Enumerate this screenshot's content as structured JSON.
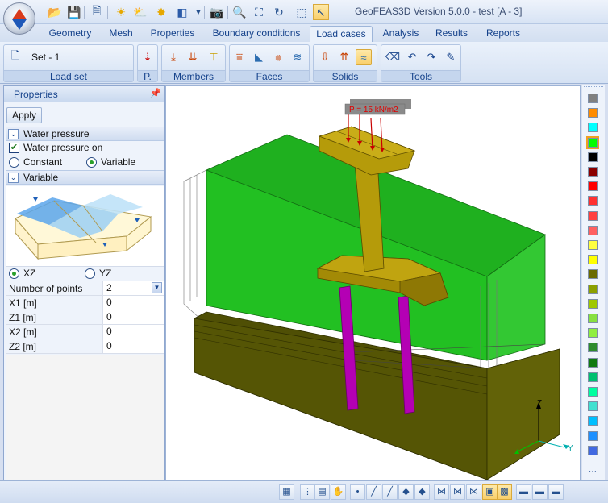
{
  "window": {
    "title": "GeoFEAS3D Version 5.0.0 - test [A - 3]"
  },
  "quick_access": [
    "open-icon",
    "save-icon",
    "print-preview-icon",
    "sun-icon",
    "cloud-sun-icon",
    "light-icon",
    "cube-icon",
    "dropdown-icon",
    "camera-icon",
    "zoom-icon",
    "zoom-window-icon",
    "rotate-icon",
    "select-icon",
    "pointer-icon"
  ],
  "tabs": [
    {
      "label": "Geometry",
      "active": false
    },
    {
      "label": "Mesh",
      "active": false
    },
    {
      "label": "Properties",
      "active": false
    },
    {
      "label": "Boundary conditions",
      "active": false
    },
    {
      "label": "Load cases",
      "active": true
    },
    {
      "label": "Analysis",
      "active": false
    },
    {
      "label": "Results",
      "active": false
    },
    {
      "label": "Reports",
      "active": false
    }
  ],
  "ribbon": {
    "load_set": {
      "label": "Load set",
      "value": "Set - 1"
    },
    "point": {
      "label": "P."
    },
    "members": {
      "label": "Members"
    },
    "faces": {
      "label": "Faces"
    },
    "solids": {
      "label": "Solids"
    },
    "tools": {
      "label": "Tools"
    }
  },
  "properties": {
    "title": "Properties",
    "apply_label": "Apply",
    "water_pressure_section": "Water pressure",
    "water_pressure_on_label": "Water pressure on",
    "water_pressure_on": true,
    "mode_constant": "Constant",
    "mode_variable": "Variable",
    "mode_selected": "Variable",
    "variable_section": "Variable",
    "plane_xz": "XZ",
    "plane_yz": "YZ",
    "plane_selected": "XZ",
    "rows": [
      {
        "key": "Number of points",
        "value": "2"
      },
      {
        "key": "X1  [m]",
        "value": "0"
      },
      {
        "key": "Z1  [m]",
        "value": "0"
      },
      {
        "key": "X2  [m]",
        "value": "0"
      },
      {
        "key": "Z2  [m]",
        "value": "0"
      }
    ]
  },
  "viewport": {
    "load_label": "P = 15 kN/m2",
    "axis_z": "Z",
    "axis_y": "Y",
    "colors": {
      "soil_top": "#1fa51f",
      "soil_bottom": "#5a5a06",
      "structure": "#b49a07",
      "piles": "#b400b4",
      "load": "#c80000"
    }
  },
  "palette": [
    "#808080",
    "#ff8c00",
    "#00ffff",
    "#00ff00",
    "#000000",
    "#8b0000",
    "#ff0000",
    "#ff3030",
    "#ff4040",
    "#ff6060",
    "#ffff40",
    "#ffff00",
    "#6b6b00",
    "#8ca000",
    "#a0c800",
    "#88e040",
    "#90ee40",
    "#2e8b2e",
    "#107a10",
    "#00c070",
    "#00ffa0",
    "#40e0d0",
    "#00bfff",
    "#1e90ff",
    "#4169e1"
  ],
  "statusbar_icons": [
    "grid-icon",
    "dots-grid-icon",
    "table-icon",
    "hand-icon",
    "point-icon",
    "line-icon",
    "line2-icon",
    "surface-icon",
    "surface2-icon",
    "node-icon",
    "node2-icon",
    "node3-icon",
    "shade-icon",
    "wire-icon",
    "layer1-icon",
    "layer2-icon",
    "layer3-icon"
  ]
}
